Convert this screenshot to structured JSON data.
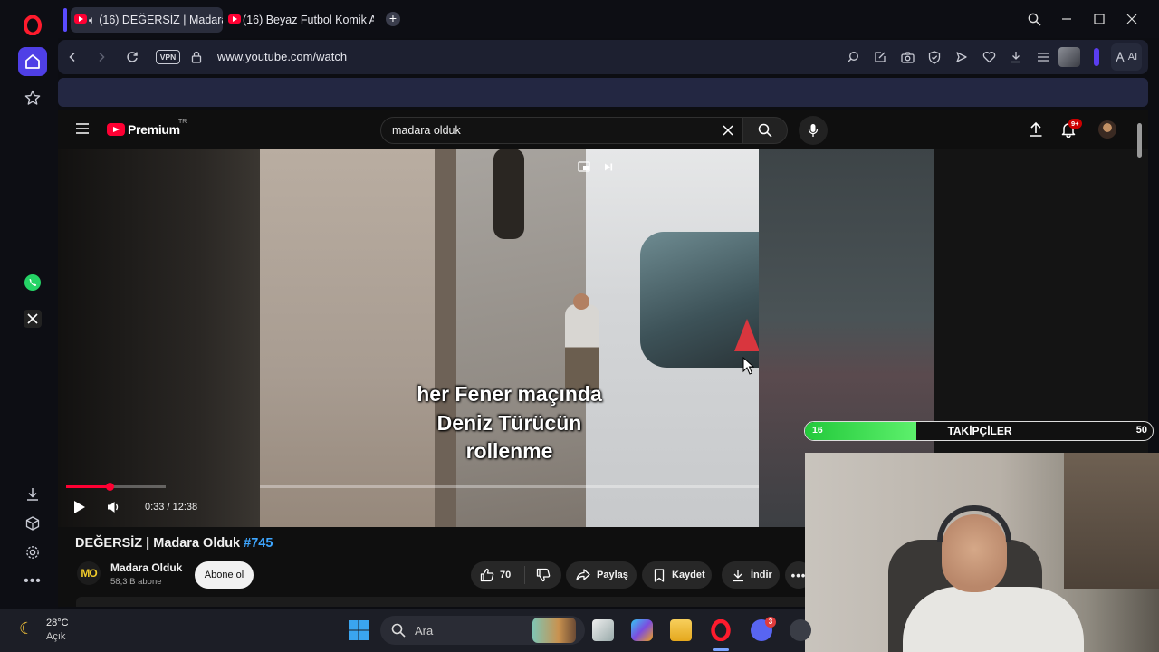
{
  "browser": {
    "tabs": [
      {
        "title": "(16) DEĞERSİZ | Madara",
        "active": true,
        "audio": true
      },
      {
        "title": "(16) Beyaz Futbol Komik A",
        "active": false,
        "audio": false
      }
    ],
    "address": {
      "vpn_label": "VPN",
      "url": "www.youtube.com/watch"
    },
    "ai_label": "AI"
  },
  "youtube": {
    "logo_text": "Premium",
    "region": "TR",
    "search": {
      "query": "madara olduk"
    },
    "notifications_badge": "9+",
    "video": {
      "caption_lines": [
        "her Fener maçında",
        "Deniz Türücün",
        "rollenme"
      ],
      "time": "0:33 / 12:38",
      "progress_fraction": 0.044,
      "title": "DEĞERSİZ | Madara Olduk",
      "hashtag": "#745"
    },
    "channel": {
      "avatar_text": "MO",
      "name": "Madara Olduk",
      "subs": "58,3 B abone",
      "subscribe_label": "Abone ol"
    },
    "actions": {
      "like_count": "70",
      "share": "Paylaş",
      "save": "Kaydet",
      "download": "İndir"
    }
  },
  "overlay": {
    "followers": {
      "current": "16",
      "label": "TAKİPÇİLER",
      "goal": "50",
      "fill_fraction": 0.32
    }
  },
  "taskbar": {
    "weather": {
      "temp": "28°C",
      "condition": "Açık"
    },
    "search_placeholder": "Ara",
    "discord_badge": "3"
  },
  "colors": {
    "accent_red": "#ff0033",
    "opera_red": "#ff1b2d",
    "follower_green": "#22c93a",
    "link_blue": "#3ea6ff"
  }
}
